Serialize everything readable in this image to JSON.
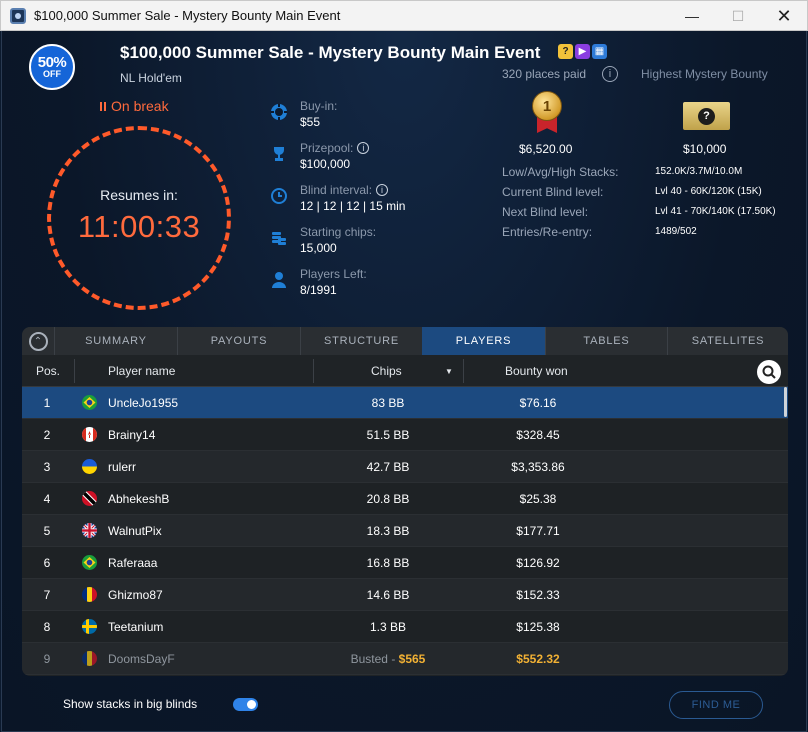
{
  "window": {
    "title": "$100,000 Summer Sale - Mystery Bounty Main Event"
  },
  "header": {
    "discount_pct": "50%",
    "discount_off": "OFF",
    "title": "$100,000 Summer Sale - Mystery Bounty Main Event",
    "game_type": "NL Hold'em",
    "title_icons": [
      "question-icon",
      "video-icon",
      "calendar-icon"
    ]
  },
  "status": {
    "label": "On break",
    "resumes_label": "Resumes in:",
    "time": "11:00:33",
    "accent_color": "#ff5a2a"
  },
  "info": {
    "buyin_label": "Buy-in:",
    "buyin_value": "$55",
    "prizepool_label": "Prizepool:",
    "prizepool_value": "$100,000",
    "blind_interval_label": "Blind interval:",
    "blind_interval_value": "12 | 12 | 12 | 15 min",
    "starting_chips_label": "Starting chips:",
    "starting_chips_value": "15,000",
    "players_left_label": "Players Left:",
    "players_left_value": "8/1991"
  },
  "prizes": {
    "places_paid": "320 places paid",
    "highest_bounty_label": "Highest Mystery Bounty",
    "first_prize": "$6,520.00",
    "first_medal": "1",
    "bounty_prize": "$10,000",
    "ticket_symbol": "?"
  },
  "stats": [
    {
      "label": "Low/Avg/High Stacks:",
      "value": "152.0K/3.7M/10.0M"
    },
    {
      "label": "Current Blind level:",
      "value": "Lvl 40 - 60K/120K (15K)"
    },
    {
      "label": "Next Blind level:",
      "value": "Lvl 41 - 70K/140K (17.50K)"
    },
    {
      "label": "Entries/Re-entry:",
      "value": "1489/502"
    }
  ],
  "tabs": [
    {
      "label": "SUMMARY",
      "active": false
    },
    {
      "label": "PAYOUTS",
      "active": false
    },
    {
      "label": "STRUCTURE",
      "active": false
    },
    {
      "label": "PLAYERS",
      "active": true
    },
    {
      "label": "TABLES",
      "active": false
    },
    {
      "label": "SATELLITES",
      "active": false
    }
  ],
  "table": {
    "headers": {
      "pos": "Pos.",
      "name": "Player name",
      "chips": "Chips",
      "bounty": "Bounty won"
    },
    "rows": [
      {
        "pos": "1",
        "flag": "brazil",
        "name": "UncleJo1955",
        "chips": "83 BB",
        "bounty": "$76.16"
      },
      {
        "pos": "2",
        "flag": "canada",
        "name": "Brainy14",
        "chips": "51.5 BB",
        "bounty": "$328.45"
      },
      {
        "pos": "3",
        "flag": "ukraine",
        "name": "rulerr",
        "chips": "42.7 BB",
        "bounty": "$3,353.86"
      },
      {
        "pos": "4",
        "flag": "trinidad",
        "name": "AbhekeshB",
        "chips": "20.8 BB",
        "bounty": "$25.38"
      },
      {
        "pos": "5",
        "flag": "uk",
        "name": "WalnutPix",
        "chips": "18.3 BB",
        "bounty": "$177.71"
      },
      {
        "pos": "6",
        "flag": "brazil",
        "name": "Raferaaa",
        "chips": "16.8 BB",
        "bounty": "$126.92"
      },
      {
        "pos": "7",
        "flag": "romania",
        "name": "Ghizmo87",
        "chips": "14.6 BB",
        "bounty": "$152.33"
      },
      {
        "pos": "8",
        "flag": "sweden",
        "name": "Teetanium",
        "chips": "1.3 BB",
        "bounty": "$125.38"
      },
      {
        "pos": "9",
        "flag": "romania",
        "name": "DoomsDayF",
        "chips_prefix": "Busted - ",
        "chips_amount": "$565",
        "bounty": "$552.32",
        "busted": true
      }
    ]
  },
  "footer": {
    "toggle_label": "Show stacks in big blinds",
    "toggle_on": true,
    "find_me": "FIND ME"
  }
}
